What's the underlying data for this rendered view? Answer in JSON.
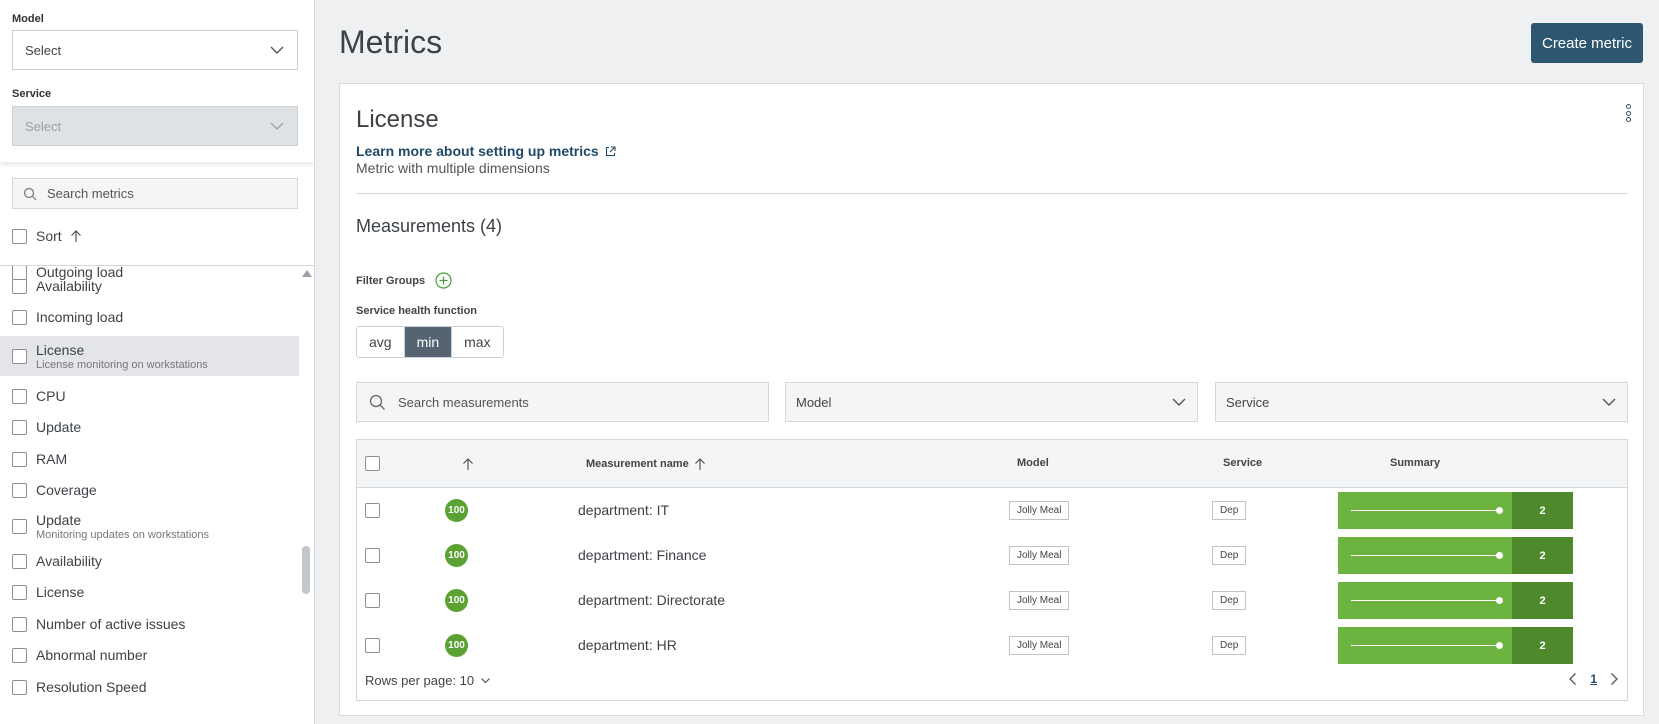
{
  "sidebar": {
    "model_label": "Model",
    "model_value": "Select",
    "service_label": "Service",
    "service_value": "Select",
    "search_placeholder": "Search metrics",
    "sort_label": "Sort",
    "items": [
      {
        "label": "Outgoing load",
        "sub": ""
      },
      {
        "label": "Availability",
        "sub": ""
      },
      {
        "label": "Incoming load",
        "sub": ""
      },
      {
        "label": "License",
        "sub": "License monitoring on workstations"
      },
      {
        "label": "CPU",
        "sub": ""
      },
      {
        "label": "Update",
        "sub": ""
      },
      {
        "label": "RAM",
        "sub": ""
      },
      {
        "label": "Coverage",
        "sub": ""
      },
      {
        "label": "Update",
        "sub": "Monitoring updates on workstations"
      },
      {
        "label": "Availability",
        "sub": ""
      },
      {
        "label": "License",
        "sub": ""
      },
      {
        "label": "Number of active issues",
        "sub": ""
      },
      {
        "label": "Abnormal number",
        "sub": ""
      },
      {
        "label": "Resolution Speed",
        "sub": ""
      }
    ]
  },
  "header": {
    "title": "Metrics",
    "create_label": "Create metric"
  },
  "card": {
    "title": "License",
    "learn_more": "Learn more about setting up metrics",
    "description": "Metric with multiple dimensions",
    "measurements_title": "Measurements (4)",
    "filter_groups": "Filter Groups",
    "health_function_label": "Service health function",
    "health_options": [
      "avg",
      "min",
      "max"
    ],
    "health_selected": "min",
    "search_placeholder": "Search measurements",
    "model_filter": "Model",
    "service_filter": "Service"
  },
  "table": {
    "columns": {
      "name": "Measurement name",
      "model": "Model",
      "service": "Service",
      "summary": "Summary"
    },
    "rows": [
      {
        "badge": "100",
        "name": "department: IT",
        "model": "Jolly Meal",
        "service": "Dep",
        "count": "2"
      },
      {
        "badge": "100",
        "name": "department: Finance",
        "model": "Jolly Meal",
        "service": "Dep",
        "count": "2"
      },
      {
        "badge": "100",
        "name": "department: Directorate",
        "model": "Jolly Meal",
        "service": "Dep",
        "count": "2"
      },
      {
        "badge": "100",
        "name": "department: HR",
        "model": "Jolly Meal",
        "service": "Dep",
        "count": "2"
      }
    ],
    "rows_per_page": "Rows per page: 10",
    "page": "1"
  },
  "colors": {
    "accent": "#2d5670",
    "health_good": "#5ba133",
    "summary_bar": "#6db33f",
    "summary_count": "#4e8a2b"
  }
}
